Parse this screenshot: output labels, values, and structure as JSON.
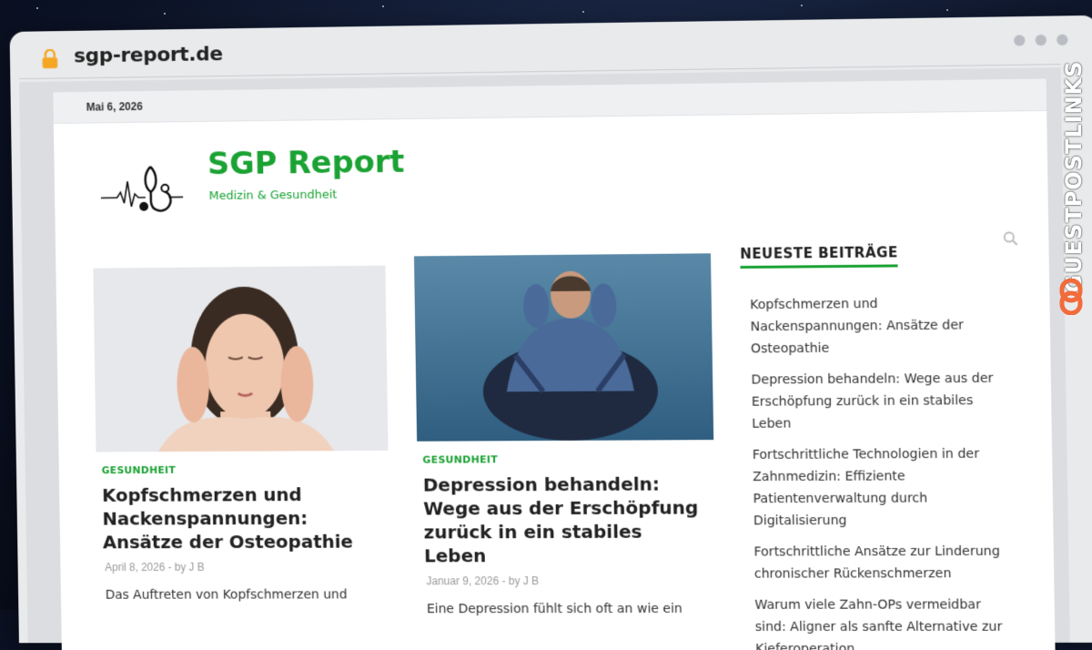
{
  "browser": {
    "url": "sgp-report.de"
  },
  "topbar": {
    "date": "Mai 6, 2026"
  },
  "site": {
    "title": "SGP Report",
    "description": "Medizin & Gesundheit",
    "accent_color": "#1aa233"
  },
  "posts": [
    {
      "category": "GESUNDHEIT",
      "title": "Kopfschmerzen und Nackenspannungen: Ansätze der Osteopathie",
      "date": "April 8, 2026",
      "author": "by J B",
      "excerpt": "Das Auftreten von Kopfschmerzen und"
    },
    {
      "category": "GESUNDHEIT",
      "title": "Depression behandeln: Wege aus der Erschöpfung zurück in ein stabiles Leben",
      "date": "Januar 9, 2026",
      "author": "by J B",
      "excerpt": "Eine Depression fühlt sich oft an wie ein"
    }
  ],
  "sidebar": {
    "title": "NEUESTE BEITRÄGE",
    "items": [
      "Kopfschmerzen und Nackenspannungen: Ansätze der Osteopathie",
      "Depression behandeln: Wege aus der Erschöpfung zurück in ein stabiles Leben",
      "Fortschrittliche Technologien in der Zahnmedizin: Effiziente Patientenverwaltung durch Digitalisierung",
      "Fortschrittliche Ansätze zur Linderung chronischer Rückenschmerzen",
      "Warum viele Zahn-OPs vermeidbar sind: Aligner als sanfte Alternative zur Kieferoperation"
    ]
  },
  "watermark": {
    "text": "GUESTPOSTLINKS"
  },
  "icons": [
    "lock-icon",
    "stethoscope-logo-icon",
    "search-icon",
    "link-icon"
  ]
}
